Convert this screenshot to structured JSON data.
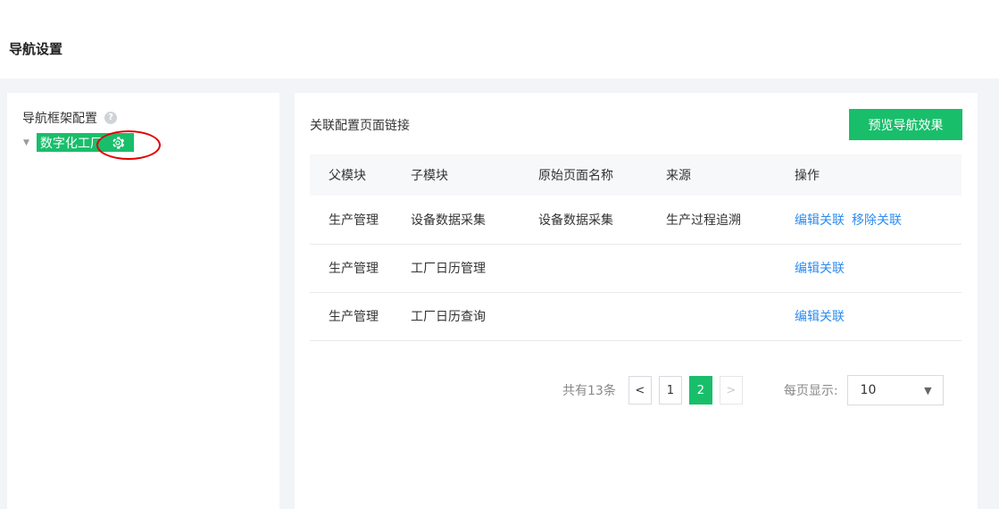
{
  "page": {
    "title": "导航设置"
  },
  "tree": {
    "title": "导航框架配置",
    "help_icon": "?",
    "node": {
      "label": "数字化工厂",
      "icon": "gear-icon"
    }
  },
  "panel": {
    "title": "关联配置页面链接",
    "preview_button": "预览导航效果"
  },
  "table": {
    "headers": [
      "父模块",
      "子模块",
      "原始页面名称",
      "来源",
      "操作"
    ],
    "rows": [
      {
        "parent": "生产管理",
        "child": "设备数据采集",
        "original": "设备数据采集",
        "source": "生产过程追溯",
        "actions": [
          "编辑关联",
          "移除关联"
        ]
      },
      {
        "parent": "生产管理",
        "child": "工厂日历管理",
        "original": "",
        "source": "",
        "actions": [
          "编辑关联"
        ]
      },
      {
        "parent": "生产管理",
        "child": "工厂日历查询",
        "original": "",
        "source": "",
        "actions": [
          "编辑关联"
        ]
      }
    ]
  },
  "pagination": {
    "total_text": "共有13条",
    "prev": "<",
    "next": ">",
    "pages": [
      "1",
      "2"
    ],
    "current_page": "2",
    "page_size_label": "每页显示:",
    "page_size": "10"
  },
  "colors": {
    "accent": "#19be6b",
    "link": "#2d8cf0",
    "highlight": "#e00000"
  }
}
